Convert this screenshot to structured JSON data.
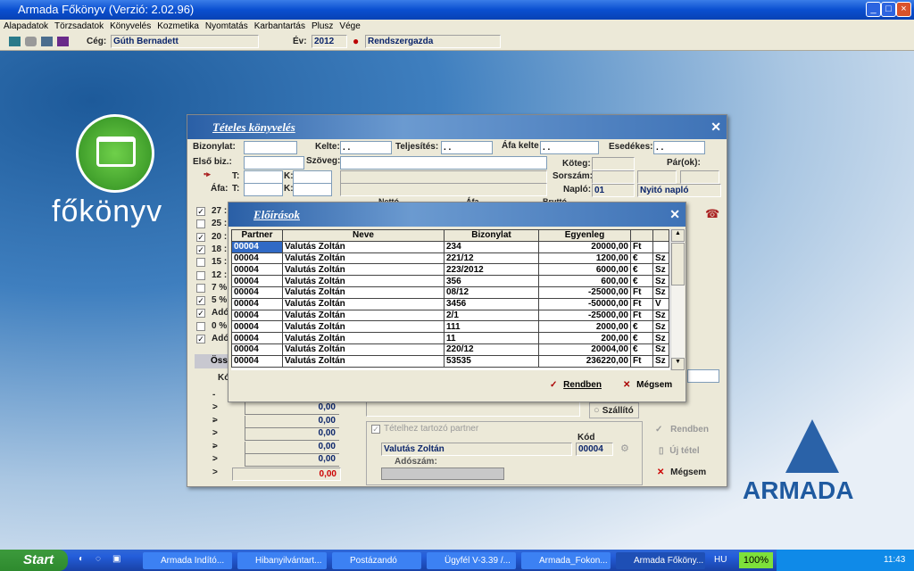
{
  "app": {
    "title": "Armada Főkönyv (Verzió: 2.02.96)"
  },
  "menu": [
    "Alapadatok",
    "Törzsadatok",
    "Könyvelés",
    "Kozmetika",
    "Nyomtatás",
    "Karbantartás",
    "Plusz",
    "Vége"
  ],
  "toolbar": {
    "ceg_label": "Cég:",
    "ceg_value": "Gúth Bernadett",
    "ev_label": "Év:",
    "ev_value": "2012",
    "user": "Rendszergazda"
  },
  "desktop": {
    "logo_text": "főkönyv",
    "brand": "ARMADA"
  },
  "main_dialog": {
    "title": "Tételes könyvelés",
    "bizonylat_label": "Bizonylat:",
    "kelte_label": "Kelte:",
    "kelte_value": ". .",
    "teljesites_label": "Teljesítés:",
    "teljesites_value": ". .",
    "afa_kelte_label": "Áfa kelte",
    "afa_kelte_value": ". .",
    "esedekes_label": "Esedékes:",
    "esedekes_value": ". .",
    "elso_biz_label": "Első biz.:",
    "szoveg_label": "Szöveg:",
    "t_label": "T:",
    "k_label": "K:",
    "afa_label": "Áfa:",
    "koteg_label": "Köteg:",
    "parok_label": "Pár(ok):",
    "sorszam_label": "Sorszám:",
    "naplo_label": "Napló:",
    "naplo_value": "01",
    "naplo_select": "Nyitó napló",
    "col_headers": [
      "Nettó",
      "Áfa",
      "Bruttó"
    ],
    "vat_rows": [
      {
        "label": "27 :",
        "checked": true
      },
      {
        "label": "25 :",
        "checked": false
      },
      {
        "label": "20 :",
        "checked": true
      },
      {
        "label": "18 :",
        "checked": true
      },
      {
        "label": "15 :",
        "checked": false
      },
      {
        "label": "12 :",
        "checked": false
      },
      {
        "label": "7 %",
        "checked": false
      },
      {
        "label": "5 %",
        "checked": true
      },
      {
        "label": "Adó",
        "checked": true
      },
      {
        "label": "0 %",
        "checked": false
      },
      {
        "label": "Adó",
        "checked": true
      }
    ],
    "ossz_label": "Öss",
    "ko_label": "Kó",
    "arrow_rows": [
      "->",
      "->",
      "->",
      "->",
      "->",
      "->"
    ],
    "amounts": [
      "0,00",
      "0,00",
      "0,00",
      "0,00",
      "0,00"
    ],
    "total": "0,00",
    "szallito_label": "Szállító",
    "partner_check_label": "Tételhez tartozó partner",
    "kod_label": "Kód",
    "partner_name": "Valutás Zoltán",
    "partner_code": "00004",
    "adoszam_label": "Adószám:",
    "rendben": "Rendben",
    "uj_tetel": "Új tétel",
    "megsem": "Mégsem"
  },
  "eloirasok": {
    "title": "Előírások",
    "headers": [
      "Partner",
      "Neve",
      "Bizonylat",
      "Egyenleg",
      "",
      ""
    ],
    "rows": [
      [
        "00004",
        "Valutás Zoltán",
        "234",
        "20000,00",
        "Ft",
        ""
      ],
      [
        "00004",
        "Valutás Zoltán",
        "221/12",
        "1200,00",
        "€",
        "Sz"
      ],
      [
        "00004",
        "Valutás Zoltán",
        "223/2012",
        "6000,00",
        "€",
        "Sz"
      ],
      [
        "00004",
        "Valutás Zoltán",
        "356",
        "600,00",
        "€",
        "Sz"
      ],
      [
        "00004",
        "Valutás Zoltán",
        "08/12",
        "-25000,00",
        "Ft",
        "Sz"
      ],
      [
        "00004",
        "Valutás Zoltán",
        "3456",
        "-50000,00",
        "Ft",
        "V"
      ],
      [
        "00004",
        "Valutás Zoltán",
        "2/1",
        "-25000,00",
        "Ft",
        "Sz"
      ],
      [
        "00004",
        "Valutás Zoltán",
        "111",
        "2000,00",
        "€",
        "Sz"
      ],
      [
        "00004",
        "Valutás Zoltán",
        "11",
        "200,00",
        "€",
        "Sz"
      ],
      [
        "00004",
        "Valutás Zoltán",
        "220/12",
        "20004,00",
        "€",
        "Sz"
      ],
      [
        "00004",
        "Valutás Zoltán",
        "53535",
        "236220,00",
        "Ft",
        "Sz"
      ]
    ],
    "rendben": "Rendben",
    "megsem": "Mégsem"
  },
  "taskbar": {
    "start": "Start",
    "tasks": [
      "Armada Indító...",
      "Hibanyilvántart...",
      "Postázandó üze...",
      "Ügyfél V-3.39 /...",
      "Armada_Fokon...",
      "Armada Főköny..."
    ],
    "lang": "HU",
    "zoom": "100%",
    "clock": "11:43"
  }
}
